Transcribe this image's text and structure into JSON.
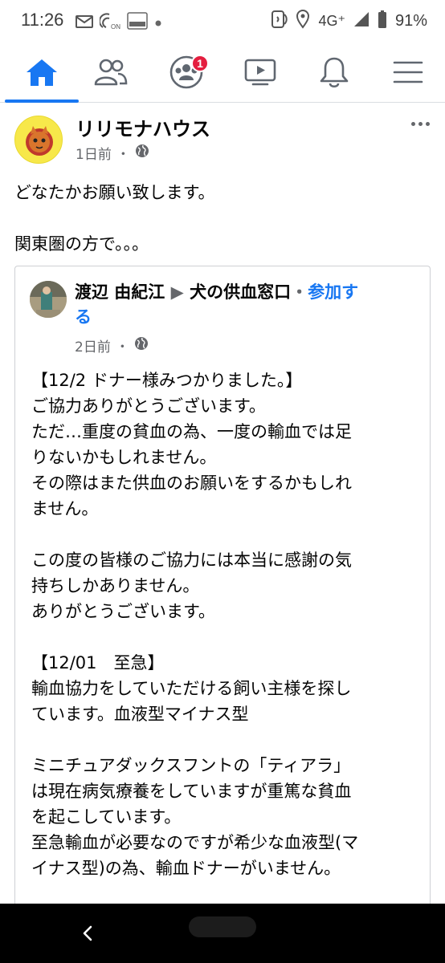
{
  "status_bar": {
    "time": "11:26",
    "network": "4G⁺",
    "battery_percent": "91%",
    "icons": [
      "mail-icon",
      "data-saver-icon",
      "connect-omron-icon",
      "dot-icon",
      "nfc-icon",
      "location-icon",
      "signal-icon",
      "battery-icon"
    ]
  },
  "nav": {
    "tabs": [
      {
        "name": "home",
        "icon": "home-icon",
        "active": true
      },
      {
        "name": "friends",
        "icon": "friends-icon",
        "active": false
      },
      {
        "name": "groups",
        "icon": "groups-icon",
        "active": false,
        "badge": "1"
      },
      {
        "name": "watch",
        "icon": "video-icon",
        "active": false
      },
      {
        "name": "notifications",
        "icon": "bell-icon",
        "active": false
      },
      {
        "name": "menu",
        "icon": "hamburger-icon",
        "active": false
      }
    ],
    "accent": "#1877f2",
    "badge_color": "#e41e3f"
  },
  "post": {
    "page_name": "リリモナハウス",
    "time": "1日前",
    "separator": "・",
    "privacy_icon": "globe-icon",
    "text_lines": [
      "どなたかお願い致します。",
      "",
      "関東圏の方で。。。"
    ]
  },
  "shared_post": {
    "author": "渡辺 由紀江",
    "arrow": "▶",
    "group": "犬の供血窓口",
    "separator": "・",
    "join_line1": "参加す",
    "join_line2": "る",
    "time": "2日前",
    "body_lines": [
      "【12/2 ドナー様みつかりました。】",
      "ご協力ありがとうございます。",
      "ただ…重度の貧血の為、一度の輸血では足",
      "りないかもしれません。",
      "その際はまた供血のお願いをするかもしれ",
      "ません。",
      "",
      "この度の皆様のご協力には本当に感謝の気",
      "持ちしかありません。",
      "ありがとうございます。",
      "",
      "【12/01　至急】",
      "輸血協力をしていただける飼い主様を探し",
      "ています。血液型マイナス型",
      "",
      "ミニチュアダックスフントの「ティアラ」",
      "は現在病気療養をしていますが重篤な貧血",
      "を起こしています。",
      "至急輸血が必要なのですが希少な血液型(マ",
      "イナス型)の為、輸血ドナーがいません。"
    ]
  },
  "system_nav": {
    "back_icon": "back-chevron-icon",
    "home_icon": "home-pill-icon"
  }
}
